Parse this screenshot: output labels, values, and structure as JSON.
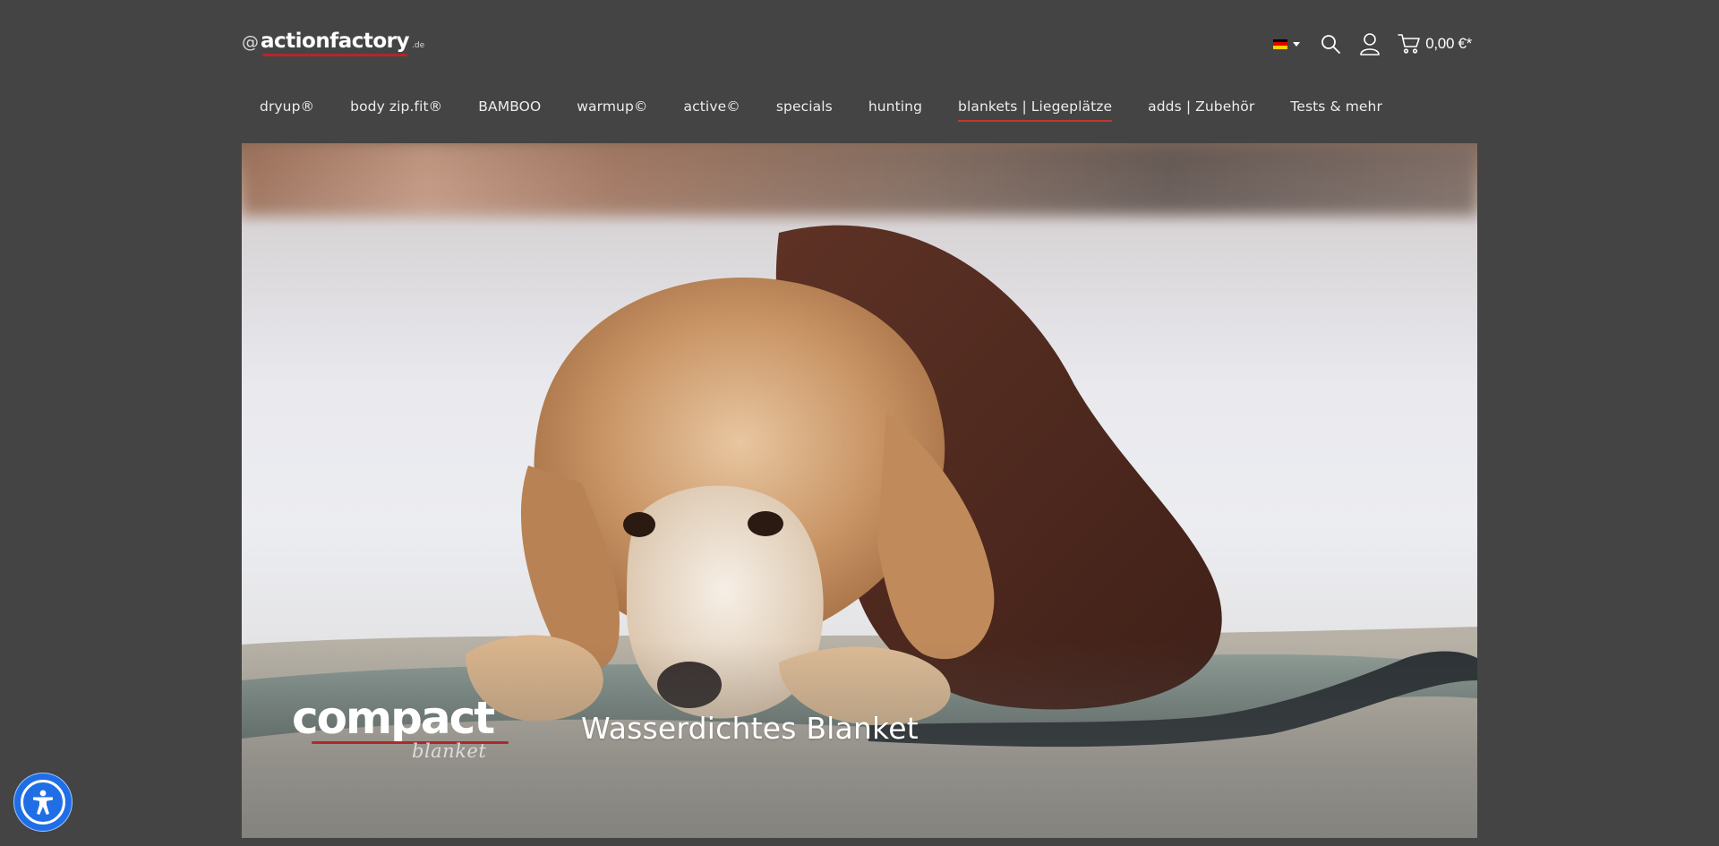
{
  "header": {
    "logo": {
      "at": "@",
      "name": "actionfactory",
      "tld": ".de"
    },
    "language": {
      "flag_colors": [
        "#000000",
        "#dd0000",
        "#ffce00"
      ],
      "icon": "chevron-down-icon"
    },
    "icons": {
      "search": "search-icon",
      "account": "user-icon",
      "cart": "cart-icon"
    },
    "cart_total": "0,00 €*"
  },
  "nav": {
    "items": [
      {
        "label": "dryup®"
      },
      {
        "label": "body zip.fit®"
      },
      {
        "label": "BAMBOO"
      },
      {
        "label": "warmup©"
      },
      {
        "label": "active©"
      },
      {
        "label": "specials"
      },
      {
        "label": "hunting"
      },
      {
        "label": "blankets | Liegeplätze",
        "active": true
      },
      {
        "label": "adds | Zubehör"
      },
      {
        "label": "Tests & mehr"
      }
    ]
  },
  "hero": {
    "brand_name": "compact",
    "brand_sub": "blanket",
    "headline": "Wasserdichtes Blanket"
  },
  "accessibility": {
    "icon": "accessibility-icon"
  },
  "colors": {
    "background": "#444444",
    "accent": "#b1282b",
    "a11y": "#1f6ee6"
  }
}
